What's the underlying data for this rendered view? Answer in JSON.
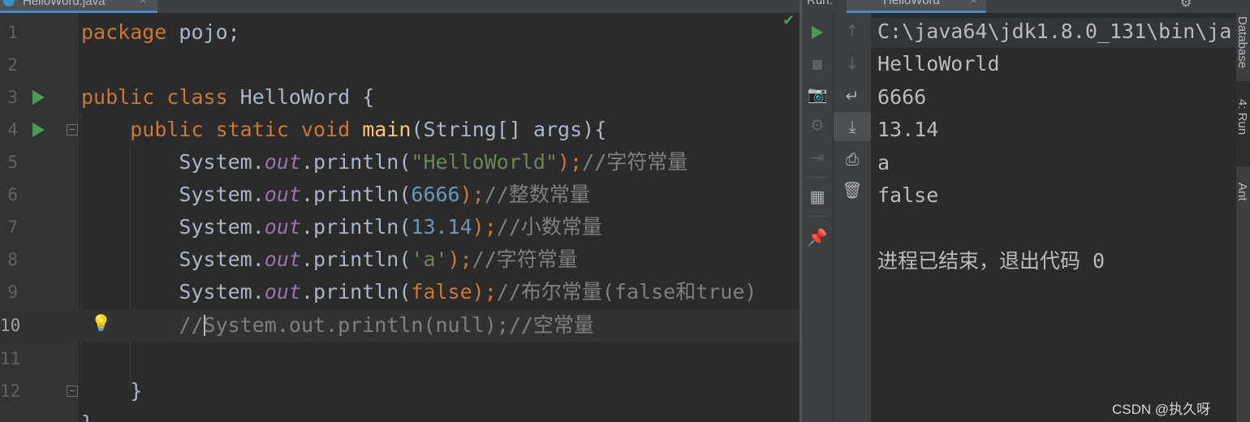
{
  "editor": {
    "tab_title": "HelloWord.java",
    "lines": [
      {
        "n": "1"
      },
      {
        "n": "2"
      },
      {
        "n": "3"
      },
      {
        "n": "4"
      },
      {
        "n": "5"
      },
      {
        "n": "6"
      },
      {
        "n": "7"
      },
      {
        "n": "8"
      },
      {
        "n": "9"
      },
      {
        "n": "10"
      },
      {
        "n": "11"
      },
      {
        "n": "12"
      }
    ],
    "code": {
      "l1_kw": "package",
      "l1_rest": " pojo;",
      "l3_kw": "public class",
      "l3_rest": " HelloWord {",
      "l4_indent": "    ",
      "l4_kw": "public static void",
      "l4_fn": "main",
      "l4_rest": "(String[] args){",
      "l5_a": "        System.",
      "l5_out": "out",
      "l5_b": ".println(",
      "l5_str": "\"HelloWorld\"",
      "l5_c": ");",
      "l5_cmt": "//字符常量",
      "l6_a": "        System.",
      "l6_out": "out",
      "l6_b": ".println(",
      "l6_num": "6666",
      "l6_c": ");",
      "l6_cmt": "//整数常量",
      "l7_a": "        System.",
      "l7_out": "out",
      "l7_b": ".println(",
      "l7_num": "13.14",
      "l7_c": ");",
      "l7_cmt": "//小数常量",
      "l8_a": "        System.",
      "l8_out": "out",
      "l8_b": ".println(",
      "l8_str": "'a'",
      "l8_c": ");",
      "l8_cmt": "//字符常量",
      "l9_a": "        System.",
      "l9_out": "out",
      "l9_b": ".println(",
      "l9_kw": "false",
      "l9_c": ");",
      "l9_cmt": "//布尔常量(false和true)",
      "l10_indent": "        ",
      "l10_a": "//",
      "l10_b": "System.out.println(null);//空常量",
      "l12": "    }",
      "l13": "}"
    }
  },
  "run_panel": {
    "header_label": "Run:",
    "tab_label": "HelloWord",
    "console_lines": [
      "C:\\java64\\jdk1.8.0_131\\bin\\ja",
      "HelloWorld",
      "6666",
      "13.14",
      "a",
      "false",
      "",
      "进程已结束，退出代码 0"
    ],
    "toolbar1": [
      "rerun-icon",
      "stop-icon",
      "camera-icon",
      "settings-icon",
      "exit-icon",
      "layout-icon",
      "pin-icon"
    ],
    "toolbar2": [
      "up-arrow-icon",
      "down-arrow-icon",
      "soft-wrap-icon",
      "scroll-to-end-icon",
      "print-icon",
      "trash-icon"
    ]
  },
  "right_strip": {
    "database": "Database",
    "run": "4: Run",
    "ant": "Ant"
  },
  "watermark": "CSDN @执久呀",
  "colors": {
    "background": "#2b2b2b",
    "keyword": "#cc7832",
    "function": "#ffc66d",
    "field": "#9876aa",
    "string": "#6a8759",
    "number": "#6897bb",
    "comment": "#808080",
    "run_green": "#499c54"
  }
}
